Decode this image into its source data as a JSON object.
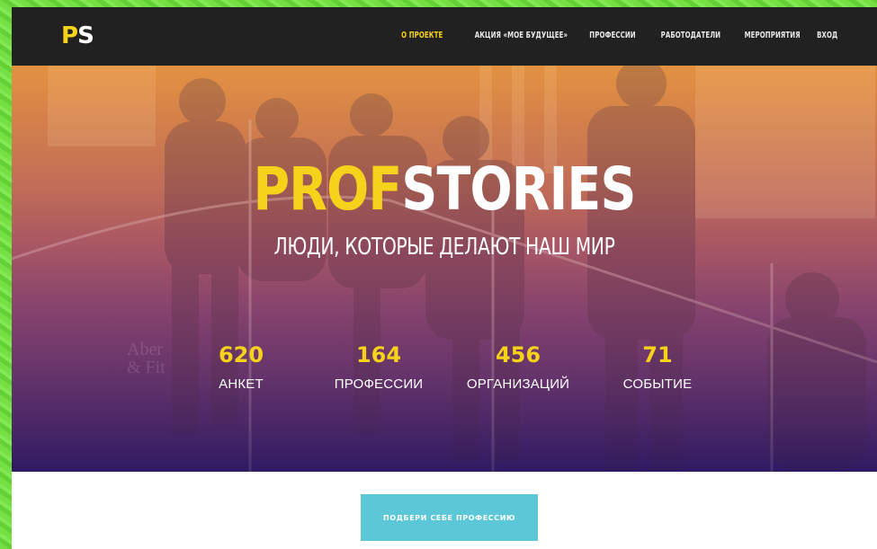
{
  "header": {
    "logo_p": "P",
    "logo_s": "S",
    "nav": [
      "О ПРОЕКТЕ",
      "АКЦИЯ «МОЕ БУДУЩЕЕ»",
      "ПРОФЕССИИ",
      "РАБОТОДАТЕЛИ",
      "МЕРОПРИЯТИЯ",
      "ВХОД"
    ],
    "active_index": 0
  },
  "hero": {
    "title_highlight": "PROF",
    "title_rest": "STORIES",
    "subtitle": "ЛЮДИ, КОТОРЫЕ ДЕЛАЮТ НАШ МИР",
    "background_text": "Aber & Fit",
    "stats": [
      {
        "value": "620",
        "label": "АНКЕТ"
      },
      {
        "value": "164",
        "label": "ПРОФЕССИИ"
      },
      {
        "value": "456",
        "label": "ОРГАНИЗАЦИЙ"
      },
      {
        "value": "71",
        "label": "СОБЫТИЕ"
      }
    ]
  },
  "cta": {
    "label": "ПОДБЕРИ СЕБЕ ПРОФЕССИЮ"
  },
  "colors": {
    "accent_yellow": "#f7d21a",
    "nav_bg": "#212121",
    "cta_bg": "#5bc7d7",
    "frame_green": "#6fdc3e"
  }
}
